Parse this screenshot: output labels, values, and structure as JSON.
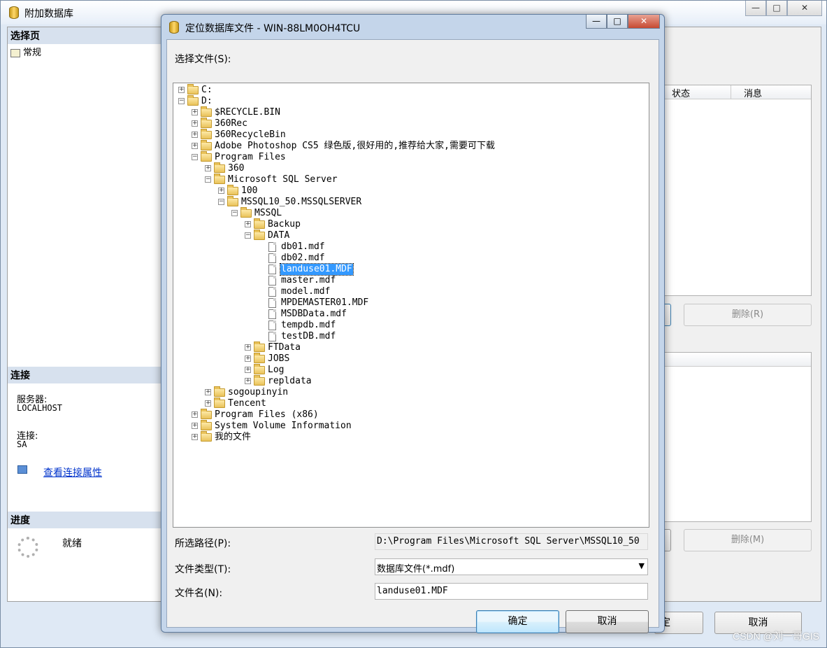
{
  "main_window": {
    "title": "附加数据库",
    "controls": [
      "—",
      "□",
      "✕"
    ],
    "select_page_header": "选择页",
    "select_page_item": "常规",
    "connection_header": "连接",
    "server_label": "服务器:",
    "server_value": "LOCALHOST",
    "connect_label": "连接:",
    "connect_value": "SA",
    "view_connection_link": "查看连接属性",
    "progress_header": "进度",
    "progress_status": "就绪",
    "grid_col_status": "状态",
    "grid_col_message": "消息",
    "remove_button_1": "删除(R)",
    "remove_button_2": "删除(M)",
    "ok_button_partial": "定",
    "cancel_button": "取消"
  },
  "dialog": {
    "title": "定位数据库文件 - WIN-88LM0OH4TCU",
    "controls": [
      "—",
      "□",
      "✕"
    ],
    "select_file_label": "选择文件(S):",
    "tree": [
      {
        "text": "C:",
        "level": 0,
        "kind": "folder",
        "exp": "+"
      },
      {
        "text": "D:",
        "level": 0,
        "kind": "folder",
        "exp": "-"
      },
      {
        "text": "$RECYCLE.BIN",
        "level": 1,
        "kind": "folder",
        "exp": "+"
      },
      {
        "text": "360Rec",
        "level": 1,
        "kind": "folder",
        "exp": "+"
      },
      {
        "text": "360RecycleBin",
        "level": 1,
        "kind": "folder",
        "exp": "+"
      },
      {
        "text": "Adobe Photoshop CS5 绿色版,很好用的,推荐给大家,需要可下载",
        "level": 1,
        "kind": "folder",
        "exp": "+"
      },
      {
        "text": "Program Files",
        "level": 1,
        "kind": "folder",
        "exp": "-"
      },
      {
        "text": "360",
        "level": 2,
        "kind": "folder",
        "exp": "+"
      },
      {
        "text": "Microsoft SQL Server",
        "level": 2,
        "kind": "folder",
        "exp": "-"
      },
      {
        "text": "100",
        "level": 3,
        "kind": "folder",
        "exp": "+"
      },
      {
        "text": "MSSQL10_50.MSSQLSERVER",
        "level": 3,
        "kind": "folder",
        "exp": "-"
      },
      {
        "text": "MSSQL",
        "level": 4,
        "kind": "folder",
        "exp": "-"
      },
      {
        "text": "Backup",
        "level": 5,
        "kind": "folder",
        "exp": "+"
      },
      {
        "text": "DATA",
        "level": 5,
        "kind": "folder",
        "exp": "-"
      },
      {
        "text": "db01.mdf",
        "level": 6,
        "kind": "file",
        "exp": ""
      },
      {
        "text": "db02.mdf",
        "level": 6,
        "kind": "file",
        "exp": ""
      },
      {
        "text": "landuse01.MDF",
        "level": 6,
        "kind": "file",
        "exp": "",
        "selected": true
      },
      {
        "text": "master.mdf",
        "level": 6,
        "kind": "file",
        "exp": ""
      },
      {
        "text": "model.mdf",
        "level": 6,
        "kind": "file",
        "exp": ""
      },
      {
        "text": "MPDEMASTER01.MDF",
        "level": 6,
        "kind": "file",
        "exp": ""
      },
      {
        "text": "MSDBData.mdf",
        "level": 6,
        "kind": "file",
        "exp": ""
      },
      {
        "text": "tempdb.mdf",
        "level": 6,
        "kind": "file",
        "exp": ""
      },
      {
        "text": "testDB.mdf",
        "level": 6,
        "kind": "file",
        "exp": ""
      },
      {
        "text": "FTData",
        "level": 5,
        "kind": "folder",
        "exp": "+"
      },
      {
        "text": "JOBS",
        "level": 5,
        "kind": "folder",
        "exp": "+"
      },
      {
        "text": "Log",
        "level": 5,
        "kind": "folder",
        "exp": "+"
      },
      {
        "text": "repldata",
        "level": 5,
        "kind": "folder",
        "exp": "+"
      },
      {
        "text": "sogoupinyin",
        "level": 2,
        "kind": "folder",
        "exp": "+"
      },
      {
        "text": "Tencent",
        "level": 2,
        "kind": "folder",
        "exp": "+"
      },
      {
        "text": "Program Files (x86)",
        "level": 1,
        "kind": "folder",
        "exp": "+"
      },
      {
        "text": "System Volume Information",
        "level": 1,
        "kind": "folder",
        "exp": "+"
      },
      {
        "text": "我的文件",
        "level": 1,
        "kind": "folder",
        "exp": "+"
      }
    ],
    "path_label": "所选路径(P):",
    "path_value": "D:\\Program Files\\Microsoft SQL Server\\MSSQL10_50",
    "type_label": "文件类型(T):",
    "type_value": "数据库文件(*.mdf)",
    "name_label": "文件名(N):",
    "name_value": "landuse01.MDF",
    "ok_button": "确定",
    "cancel_button": "取消"
  },
  "watermark": "CSDN @刘一哥GIS",
  "colors": {
    "selection": "#3399ff",
    "link": "#0033cc",
    "pane_header": "#d7e1ee"
  }
}
